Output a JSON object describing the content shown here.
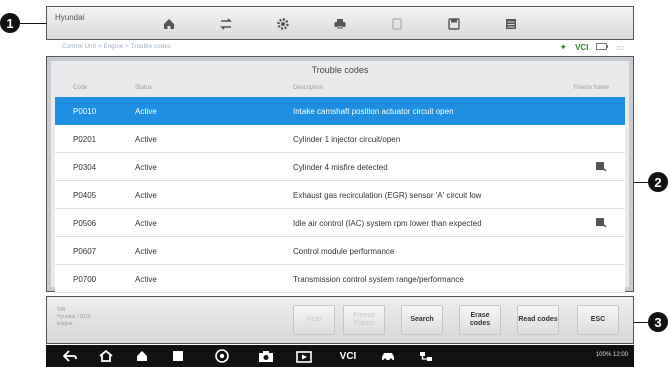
{
  "callouts": [
    "1",
    "2",
    "3"
  ],
  "topbar": {
    "brand": "Hyundai",
    "icons": [
      "home-icon",
      "vehicle-swap-icon",
      "settings-icon",
      "print-icon",
      "help-icon",
      "save-icon",
      "data-logging-icon"
    ]
  },
  "breadcrumb": {
    "text": "Control Unit > Engine > Trouble codes",
    "vci": "VCI"
  },
  "panel": {
    "title": "Trouble codes",
    "columns": [
      "Code",
      "Status",
      "Description",
      "Freeze frame"
    ]
  },
  "codes": [
    {
      "code": "P0010",
      "status": "Active",
      "desc": "Intake camshaft position actuator circuit open",
      "freeze_frame": false
    },
    {
      "code": "P0201",
      "status": "Active",
      "desc": "Cylinder 1 injector circuit/open",
      "freeze_frame": false
    },
    {
      "code": "P0304",
      "status": "Active",
      "desc": "Cylinder 4 misfire detected",
      "freeze_frame": true
    },
    {
      "code": "P0405",
      "status": "Active",
      "desc": "Exhaust gas recirculation (EGR) sensor 'A' circuit low",
      "freeze_frame": false
    },
    {
      "code": "P0506",
      "status": "Active",
      "desc": "Idle air control (IAC) system rpm lower than expected",
      "freeze_frame": true
    },
    {
      "code": "P0607",
      "status": "Active",
      "desc": "Control module performance",
      "freeze_frame": false
    },
    {
      "code": "P0700",
      "status": "Active",
      "desc": "Transmission control system range/performance",
      "freeze_frame": false
    }
  ],
  "selected_row": 0,
  "actionbar": {
    "info_line1": "VIN",
    "info_line2": "Hyundai / 2015",
    "info_line3": "Engine",
    "buttons": [
      {
        "label": "Help",
        "enabled": false
      },
      {
        "label": "Freeze Frame",
        "enabled": false
      },
      {
        "label": "Search",
        "enabled": true
      },
      {
        "label": "Erase codes",
        "enabled": true
      },
      {
        "label": "Read codes",
        "enabled": true
      },
      {
        "label": "ESC",
        "enabled": true
      }
    ]
  },
  "navbar": {
    "icons": [
      "back-icon",
      "home-icon",
      "house-icon",
      "recents-icon",
      "chrome-icon",
      "camera-icon",
      "screen-record-icon",
      "vci-icon",
      "car-icon",
      "network-icon"
    ],
    "status": "100% 12:00"
  }
}
